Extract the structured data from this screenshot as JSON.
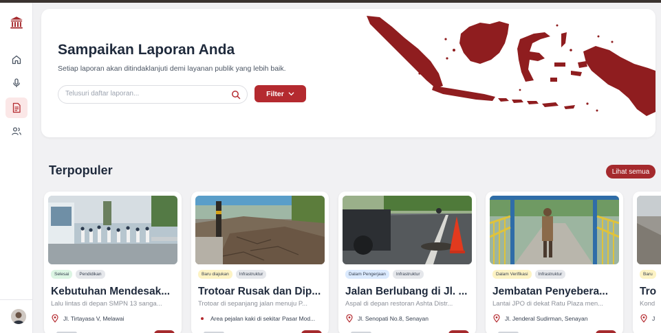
{
  "hero": {
    "title": "Sampaikan Laporan Anda",
    "subtitle": "Setiap laporan akan ditindaklanjuti demi layanan publik yang lebih baik.",
    "search_placeholder": "Telusuri daftar laporan...",
    "filter_label": "Filter"
  },
  "section": {
    "title": "Terpopuler",
    "see_all": "Lihat semua"
  },
  "cards": [
    {
      "status": "Selesai",
      "status_color": "#dcf5e3",
      "category": "Pendidikan",
      "title": "Kebutuhan Mendesak...",
      "desc": "Lalu lintas di depan SMPN 13 sanga...",
      "location": "Jl. Tirtayasa V, Melawai"
    },
    {
      "status": "Baru diajukan",
      "status_color": "#fdf3c4",
      "category": "Infrastruktur",
      "title": "Trotoar Rusak dan Dip...",
      "desc": "Trotoar di sepanjang jalan menuju P...",
      "location": "Area pejalan kaki di sekitar Pasar Mod..."
    },
    {
      "status": "Dalam Pengerjaan",
      "status_color": "#dbeafe",
      "category": "Infrastruktur",
      "title": "Jalan Berlubang di Jl. ...",
      "desc": "Aspal di depan restoran Ashta Distr...",
      "location": "Jl. Senopati No.8, Senayan"
    },
    {
      "status": "Dalam Verifikasi",
      "status_color": "#fdf3c4",
      "category": "Infrastruktur",
      "title": "Jembatan Penyebera...",
      "desc": "Lantai JPO di dekat Ratu Plaza men...",
      "location": "Jl. Jenderal Sudirman, Senayan"
    },
    {
      "status": "Baru",
      "status_color": "#fdf3c4",
      "category": "",
      "title": "Tro",
      "desc": "Kond",
      "location": "J"
    }
  ],
  "icons": {
    "logo": "government-building-icon",
    "nav": [
      "home-icon",
      "microphone-icon",
      "document-icon",
      "users-icon"
    ]
  },
  "colors": {
    "accent": "#b42a2f",
    "map": "#8f1d1f"
  }
}
